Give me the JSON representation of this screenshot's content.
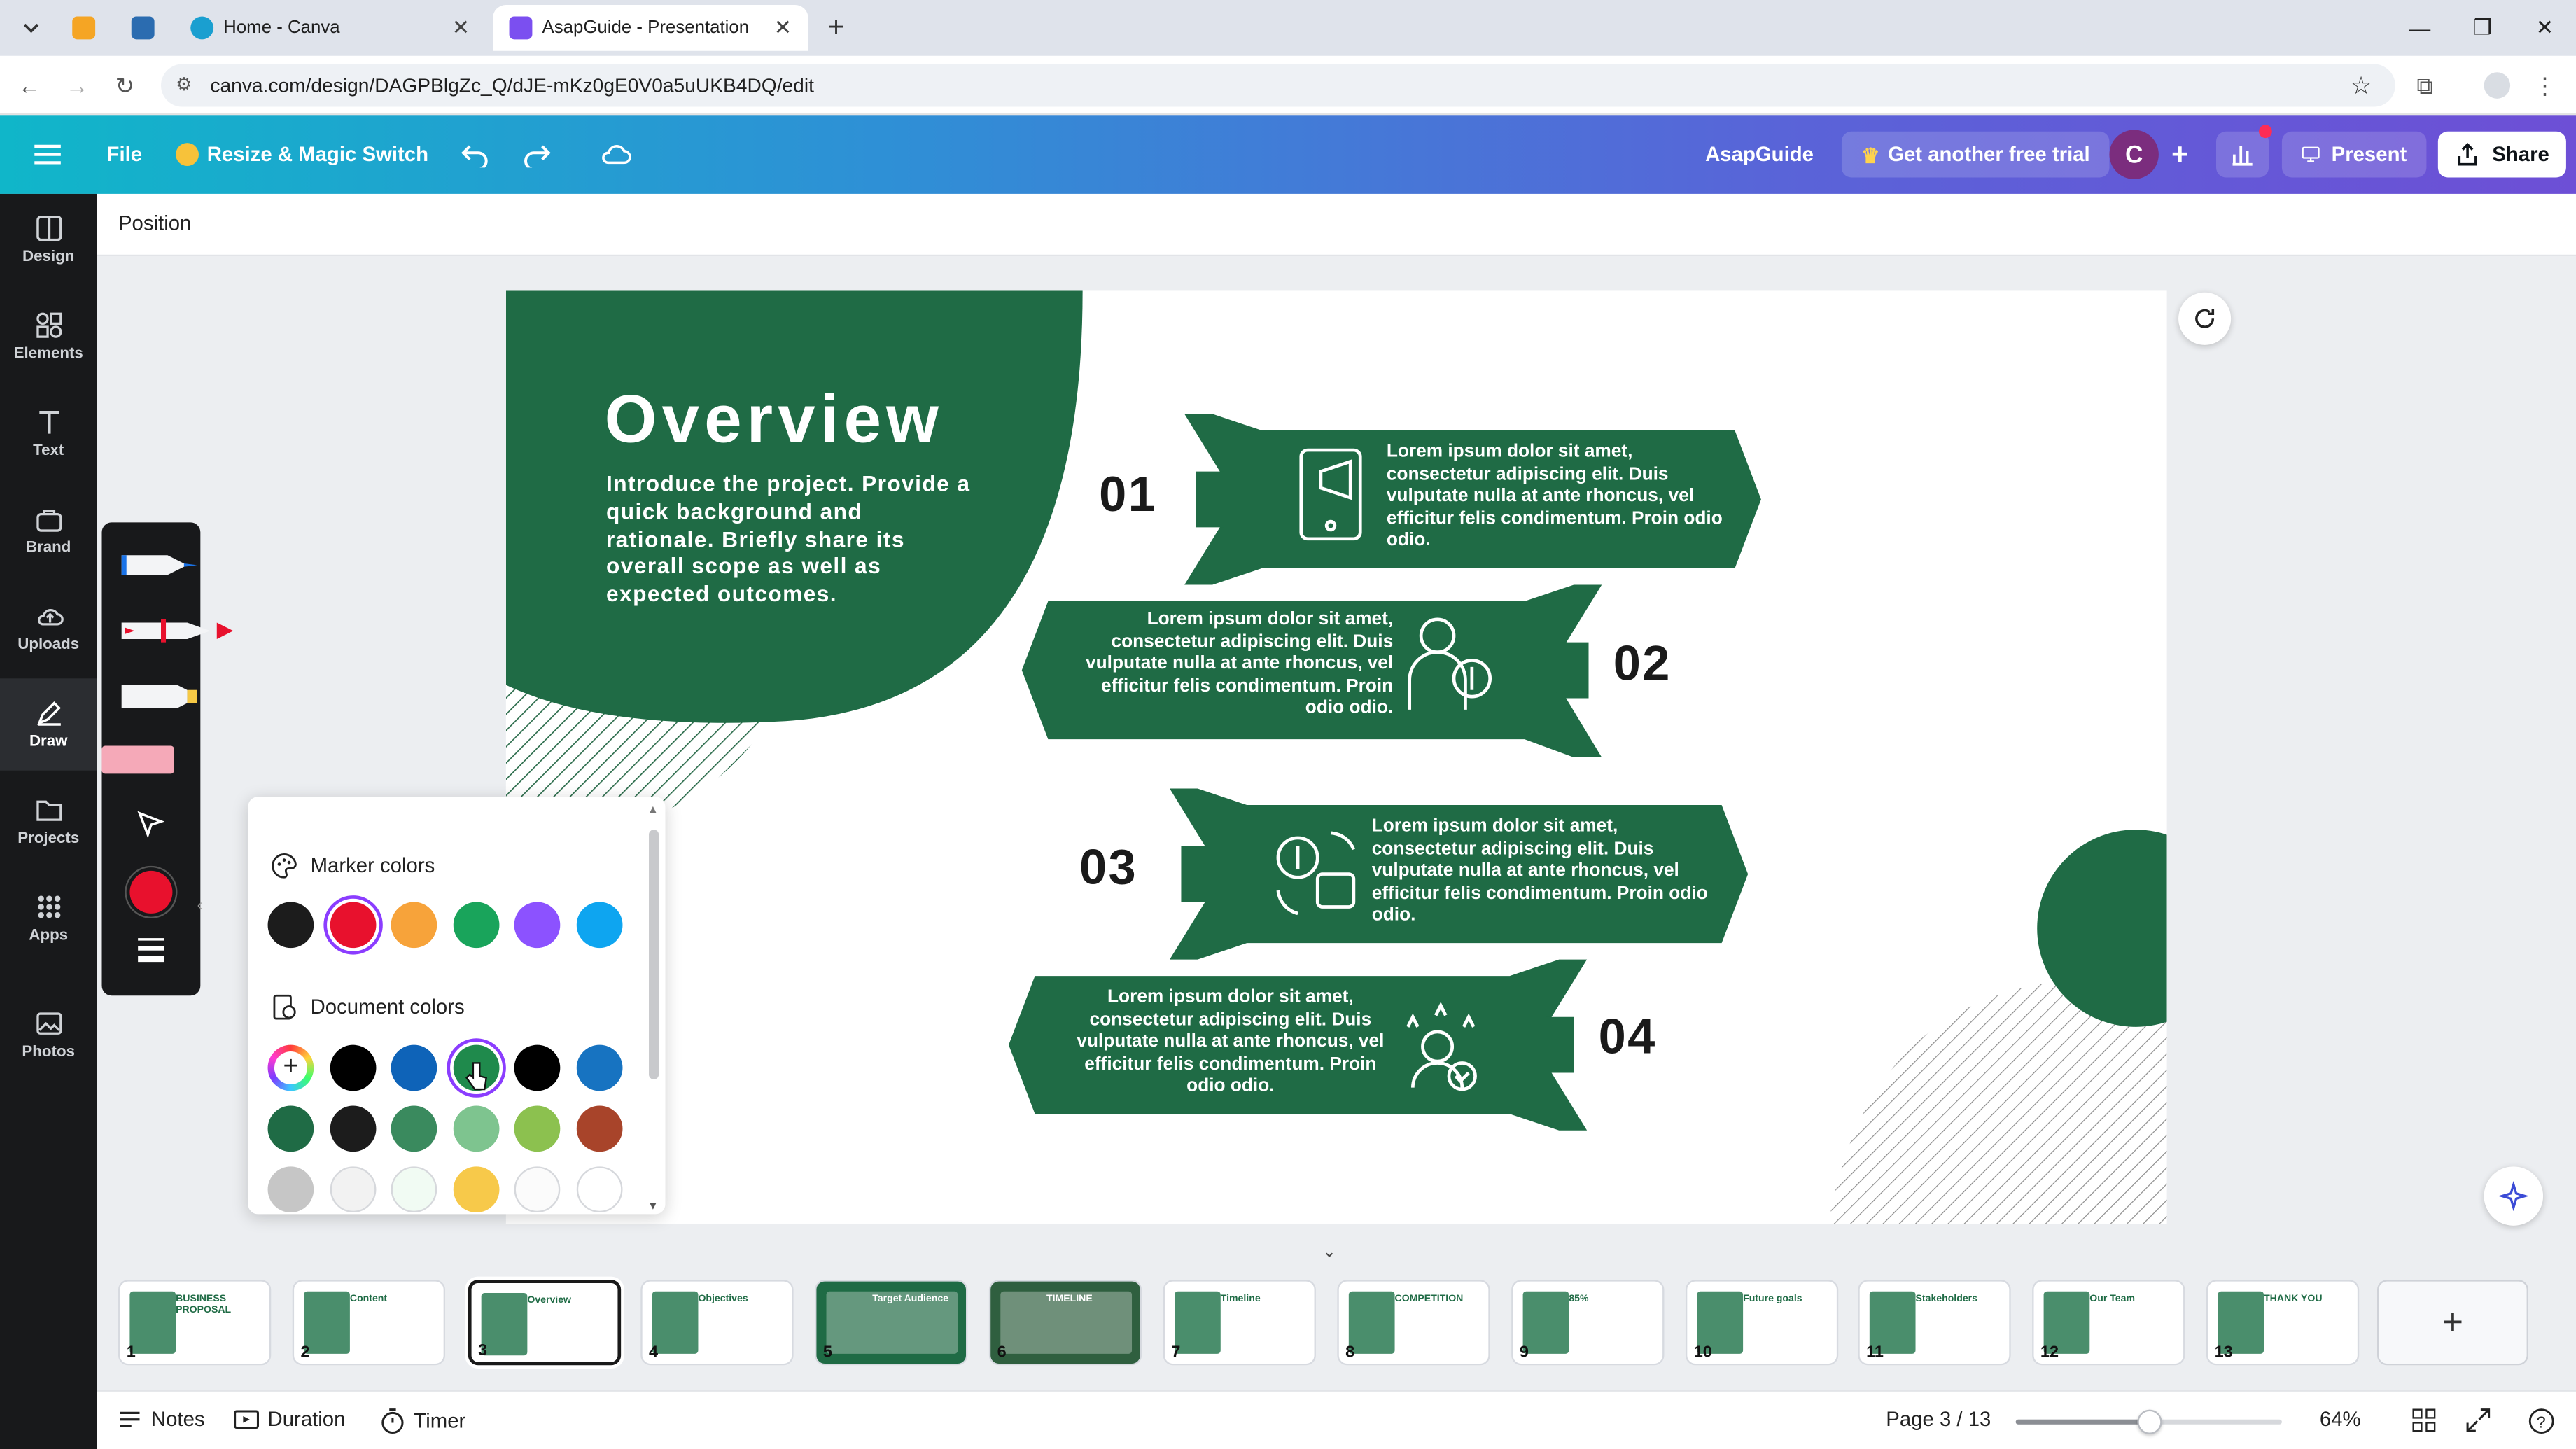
{
  "browser": {
    "tabs": [
      {
        "title": "Home - Canva",
        "active": false
      },
      {
        "title": "AsapGuide - Presentation",
        "active": true
      }
    ],
    "url": "canva.com/design/DAGPBlgZc_Q/dJE-mKz0gE0V0a5uUKB4DQ/edit"
  },
  "header": {
    "menu_icon": "hamburger-icon",
    "file_label": "File",
    "resize_label": "Resize & Magic Switch",
    "team_name": "AsapGuide",
    "trial_label": "Get another free trial",
    "avatar_letter": "C",
    "present_label": "Present",
    "share_label": "Share"
  },
  "context_bar": {
    "position_label": "Position"
  },
  "sidebar": {
    "items": [
      {
        "label": "Design",
        "icon": "design-icon"
      },
      {
        "label": "Elements",
        "icon": "elements-icon"
      },
      {
        "label": "Text",
        "icon": "text-icon"
      },
      {
        "label": "Brand",
        "icon": "brand-icon"
      },
      {
        "label": "Uploads",
        "icon": "uploads-icon"
      },
      {
        "label": "Draw",
        "icon": "draw-icon",
        "active": true
      },
      {
        "label": "Projects",
        "icon": "projects-icon"
      },
      {
        "label": "Apps",
        "icon": "apps-icon"
      },
      {
        "label": "Photos",
        "icon": "photos-icon"
      }
    ]
  },
  "palette": {
    "marker_heading": "Marker colors",
    "marker_colors": [
      "#1c1c1c",
      "#e8112d",
      "#f7a33a",
      "#19a45b",
      "#8c52ff",
      "#0ea5f0"
    ],
    "document_heading": "Document colors",
    "document_colors_row1": [
      "#000000",
      "#0e63b8",
      "#1f8a4c",
      "#000000",
      "#1773c1"
    ],
    "document_colors_row2": [
      "#1f6b45",
      "#1c1c1c",
      "#3a8a5e",
      "#7ec48f",
      "#8cc14f",
      "#a8442a"
    ],
    "document_colors_row3": [
      "#c6c6c6",
      "#f2f2f2",
      "#f1fbf3",
      "#f7c94a",
      "#fbfbfb",
      "#ffffff"
    ]
  },
  "slide": {
    "title": "Overview",
    "intro": "Introduce the project. Provide a quick background and rationale. Briefly share its overall scope as well as expected outcomes.",
    "items": [
      {
        "num": "01",
        "text": "Lorem ipsum dolor sit amet, consectetur adipiscing elit. Duis vulputate nulla at ante rhoncus, vel efficitur felis condimentum. Proin odio odio."
      },
      {
        "num": "02",
        "text": "Lorem ipsum dolor sit amet, consectetur adipiscing elit. Duis vulputate nulla at ante rhoncus, vel efficitur felis condimentum. Proin odio odio."
      },
      {
        "num": "03",
        "text": "Lorem ipsum dolor sit amet, consectetur adipiscing elit. Duis vulputate nulla at ante rhoncus, vel efficitur felis condimentum. Proin odio odio."
      },
      {
        "num": "04",
        "text": "Lorem ipsum dolor sit amet, consectetur adipiscing elit. Duis vulputate nulla at ante rhoncus, vel efficitur felis condimentum. Proin odio odio."
      }
    ],
    "brand_green": "#1f6b45"
  },
  "thumbnails": [
    {
      "num": "1",
      "caption": "BUSINESS PROPOSAL"
    },
    {
      "num": "2",
      "caption": "Content"
    },
    {
      "num": "3",
      "caption": "Overview",
      "selected": true
    },
    {
      "num": "4",
      "caption": "Objectives"
    },
    {
      "num": "5",
      "caption": "Target Audience"
    },
    {
      "num": "6",
      "caption": "TIMELINE"
    },
    {
      "num": "7",
      "caption": "Timeline"
    },
    {
      "num": "8",
      "caption": "COMPETITION"
    },
    {
      "num": "9",
      "caption": "85%"
    },
    {
      "num": "10",
      "caption": "Future goals"
    },
    {
      "num": "11",
      "caption": "Stakeholders"
    },
    {
      "num": "12",
      "caption": "Our Team"
    },
    {
      "num": "13",
      "caption": "THANK YOU"
    }
  ],
  "bottom_bar": {
    "notes_label": "Notes",
    "duration_label": "Duration",
    "timer_label": "Timer",
    "page_label": "Page 3 / 13",
    "zoom_label": "64%",
    "zoom_fraction": 0.5
  }
}
